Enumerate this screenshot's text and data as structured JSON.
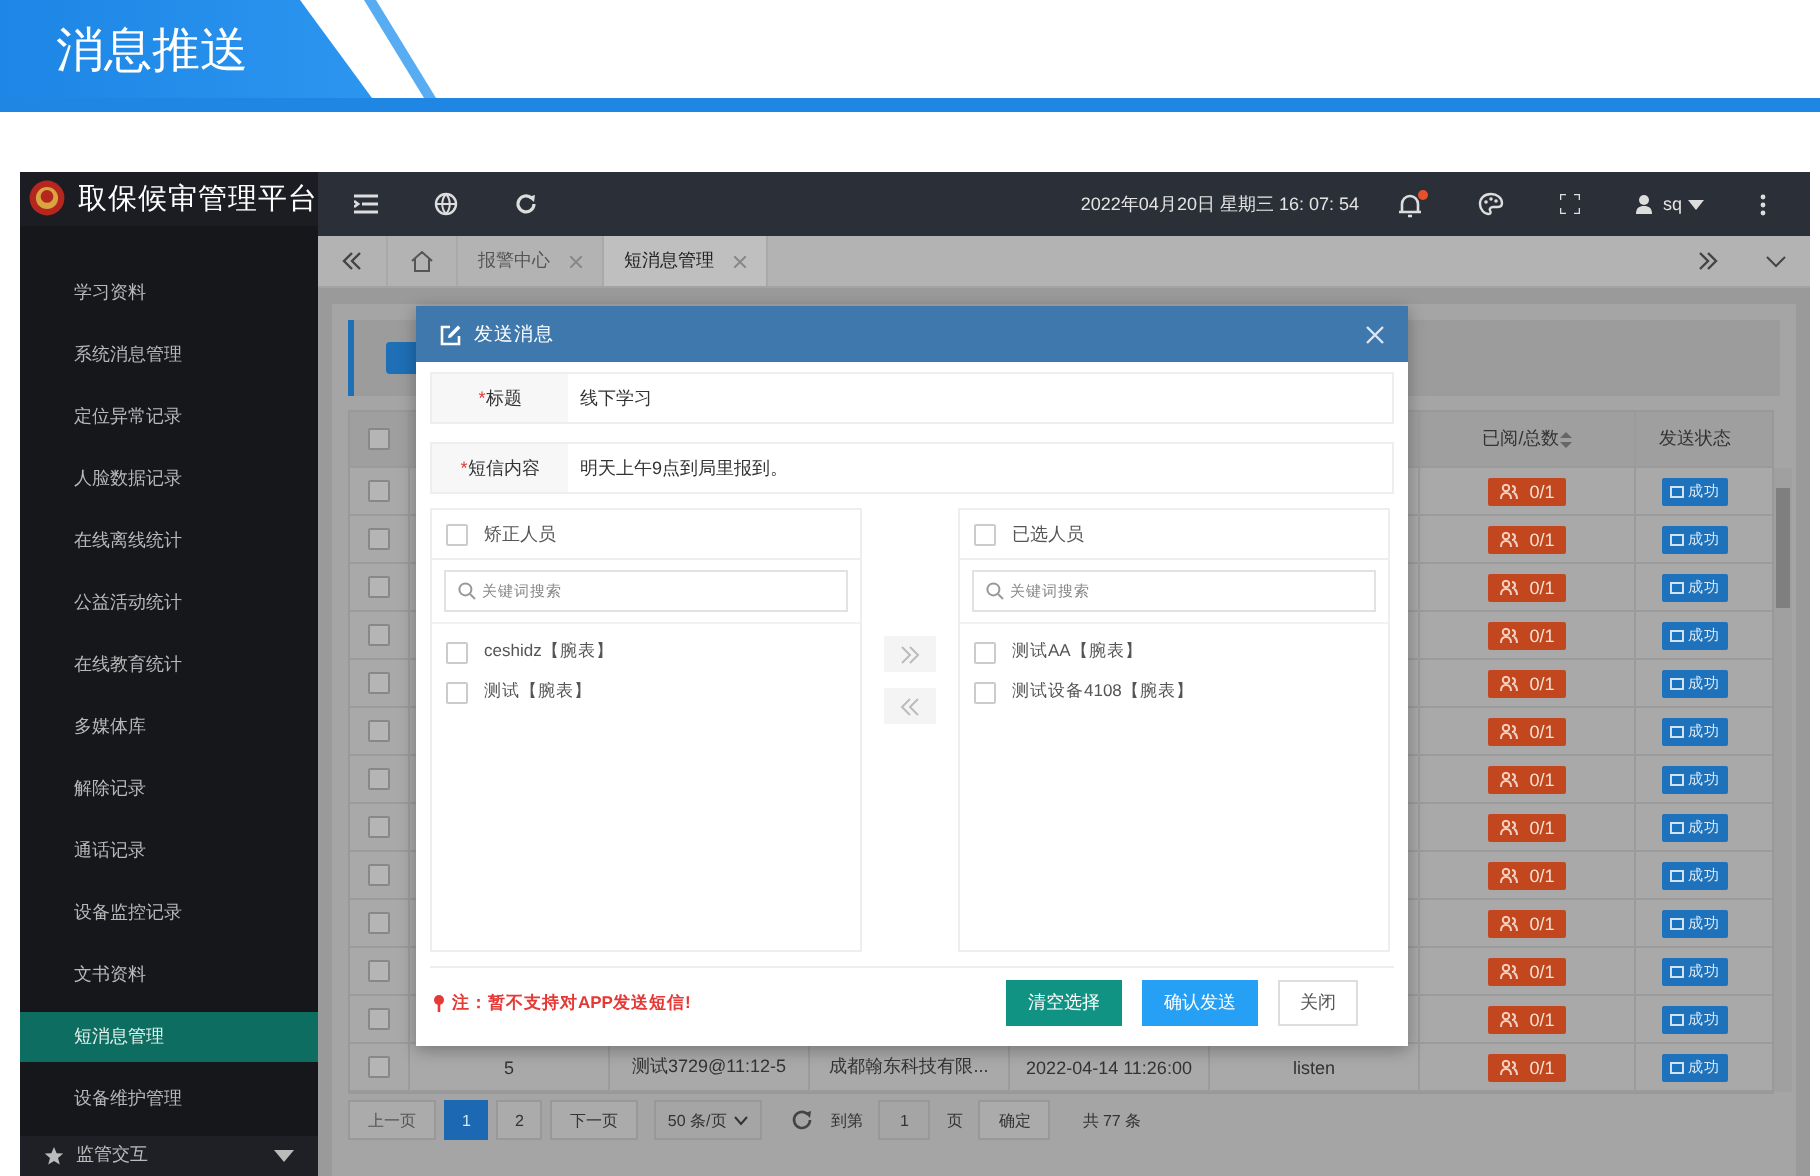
{
  "banner": {
    "title": "消息推送"
  },
  "app": {
    "logo_title": "取保候审管理平台"
  },
  "sidebar": {
    "items": [
      {
        "label": "学习资料",
        "selected": false
      },
      {
        "label": "系统消息管理",
        "selected": false
      },
      {
        "label": "定位异常记录",
        "selected": false
      },
      {
        "label": "人脸数据记录",
        "selected": false
      },
      {
        "label": "在线离线统计",
        "selected": false
      },
      {
        "label": "公益活动统计",
        "selected": false
      },
      {
        "label": "在线教育统计",
        "selected": false
      },
      {
        "label": "多媒体库",
        "selected": false
      },
      {
        "label": "解除记录",
        "selected": false
      },
      {
        "label": "通话记录",
        "selected": false
      },
      {
        "label": "设备监控记录",
        "selected": false
      },
      {
        "label": "文书资料",
        "selected": false
      },
      {
        "label": "短消息管理",
        "selected": true
      },
      {
        "label": "设备维护管理",
        "selected": false
      }
    ],
    "group": {
      "label": "监管交互",
      "expanded": false
    }
  },
  "topbar": {
    "datetime": "2022年04月20日 星期三 16: 07: 54",
    "user": "sq",
    "notification": true
  },
  "tabs": [
    {
      "label": "报警中心",
      "selected": false
    },
    {
      "label": "短消息管理",
      "selected": true
    }
  ],
  "table": {
    "all_checked": false,
    "columns": [
      "已阅/总数",
      "发送状态"
    ],
    "rows": [
      {
        "read": "0/1",
        "status": "成功",
        "checked": false
      },
      {
        "read": "0/1",
        "status": "成功",
        "checked": false
      },
      {
        "read": "0/1",
        "status": "成功",
        "checked": false
      },
      {
        "read": "0/1",
        "status": "成功",
        "checked": false
      },
      {
        "read": "0/1",
        "status": "成功",
        "checked": false
      },
      {
        "read": "0/1",
        "status": "成功",
        "checked": false
      },
      {
        "read": "0/1",
        "status": "成功",
        "checked": false
      },
      {
        "read": "0/1",
        "status": "成功",
        "checked": false
      },
      {
        "read": "0/1",
        "status": "成功",
        "checked": false
      },
      {
        "read": "0/1",
        "status": "成功",
        "checked": false
      },
      {
        "read": "0/1",
        "status": "成功",
        "checked": false
      },
      {
        "read": "0/1",
        "status": "成功",
        "checked": false
      },
      {
        "read": "0/1",
        "status": "成功",
        "checked": false,
        "cells": [
          "5",
          "测试3729@11:12-5",
          "成都翰东科技有限...",
          "2022-04-14 11:26:00",
          "listen"
        ]
      }
    ]
  },
  "pagination": {
    "prev": "上一页",
    "pages": [
      {
        "label": "1",
        "selected": true
      },
      {
        "label": "2",
        "selected": false
      }
    ],
    "next": "下一页",
    "page_size": "50 条/页",
    "goto_label": "到第",
    "goto_value": "1",
    "page_unit": "页",
    "confirm": "确定",
    "total": "共 77 条"
  },
  "dialog": {
    "title": "发送消息",
    "fields": [
      {
        "required_mark": "*",
        "label": "标题",
        "value": "线下学习"
      },
      {
        "required_mark": "*",
        "label": "短信内容",
        "value": "明天上午9点到局里报到。"
      }
    ],
    "transfer": [
      {
        "title": "矫正人员",
        "checked": false,
        "placeholder": "关键词搜索",
        "items": [
          {
            "label": "ceshidz【腕表】",
            "checked": false
          },
          {
            "label": "测试【腕表】",
            "checked": false
          }
        ]
      },
      {
        "title": "已选人员",
        "checked": false,
        "placeholder": "关键词搜索",
        "items": [
          {
            "label": "测试AA【腕表】",
            "checked": false
          },
          {
            "label": "测试设备4108【腕表】",
            "checked": false
          }
        ]
      }
    ],
    "note": "注：暂不支持对APP发送短信!",
    "buttons": [
      {
        "label": "清空选择",
        "kind": "clear"
      },
      {
        "label": "确认发送",
        "kind": "primary"
      },
      {
        "label": "关闭",
        "kind": "plain"
      }
    ]
  }
}
